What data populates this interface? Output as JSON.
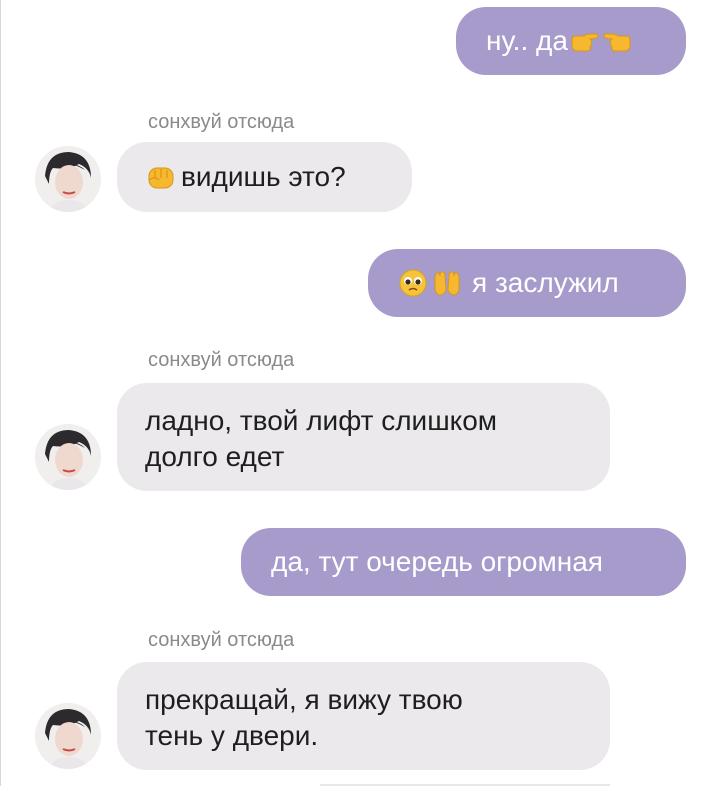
{
  "chat": {
    "sender_name": "сонхвуй отсюда",
    "messages": [
      {
        "from": "me",
        "text": "ну.. да"
      },
      {
        "from": "them",
        "text": "видишь это?"
      },
      {
        "from": "me",
        "text": "я заслужил"
      },
      {
        "from": "them",
        "lines": [
          "ладно, твой лифт слишком",
          "долго едет"
        ]
      },
      {
        "from": "me",
        "text": "да, тут очередь огромная"
      },
      {
        "from": "them",
        "lines": [
          "прекращай, я вижу твою",
          "тень у двери."
        ]
      }
    ]
  },
  "icons": {
    "msg0": [
      "pointing-right-emoji",
      "pointing-left-emoji"
    ],
    "msg1": [
      "fist-emoji"
    ],
    "msg2": [
      "pleading-face-emoji",
      "open-hands-emoji"
    ]
  },
  "colors": {
    "outgoing_bubble": "#a79bcb",
    "incoming_bubble": "#ebe9ec",
    "outgoing_text": "#ffffff",
    "incoming_text": "#1e1e1e",
    "sender_label": "#8a8a8a"
  }
}
